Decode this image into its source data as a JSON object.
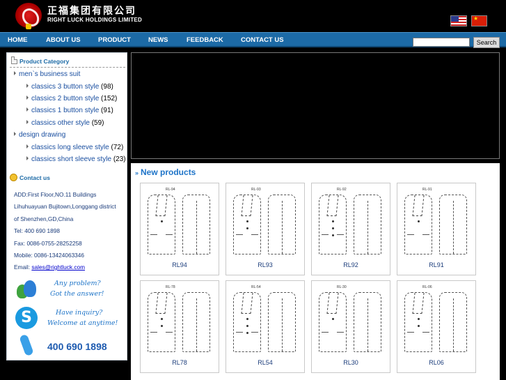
{
  "brand": {
    "name_cn": "正福集团有限公司",
    "name_en": "RIGHT LUCK HOLDINGS LIMITED"
  },
  "nav": {
    "items": [
      "HOME",
      "ABOUT US",
      "PRODUCT",
      "NEWS",
      "FEEDBACK",
      "CONTACT US"
    ],
    "search_value": "",
    "search_button": "Search"
  },
  "sidebar": {
    "category_title": "Product Category",
    "categories": [
      {
        "label": "men`s business suit",
        "count": "",
        "level": 1
      },
      {
        "label": "classics 3 button style",
        "count": "(98)",
        "level": 2
      },
      {
        "label": "classics 2 button style",
        "count": "(152)",
        "level": 2
      },
      {
        "label": "classics 1 button style",
        "count": "(91)",
        "level": 2
      },
      {
        "label": "classics other style",
        "count": "(59)",
        "level": 2
      },
      {
        "label": "design drawing",
        "count": "",
        "level": 1
      },
      {
        "label": "classics long sleeve style",
        "count": "(72)",
        "level": 2
      },
      {
        "label": "classics short sleeve style",
        "count": "(23)",
        "level": 2
      }
    ],
    "contact_title": "Contact us",
    "contact_lines": [
      "ADD:First Floor,NO.11 Buildings",
      "Lihuhuayuan Bujitown,Longgang district",
      "of Shenzhen,GD,China",
      "Tel: 400 690 1898",
      "Fax: 0086-0755-28252258",
      "Mobile: 0086-13424063346"
    ],
    "email_prefix": "Email: ",
    "email": "sales@rightluck.com",
    "msn_text": [
      "Any problem?",
      "Got the answer!"
    ],
    "skype_text": [
      "Have inquiry?",
      "Welcome at anytime!"
    ],
    "phone": "400 690 1898"
  },
  "products": {
    "title": "New products",
    "items": [
      {
        "code": "RL94",
        "tag": "RL-94"
      },
      {
        "code": "RL93",
        "tag": "RL-93"
      },
      {
        "code": "RL92",
        "tag": "RL-92"
      },
      {
        "code": "RL91",
        "tag": "RL-91"
      },
      {
        "code": "RL78",
        "tag": "RL-78"
      },
      {
        "code": "RL54",
        "tag": "RL-54"
      },
      {
        "code": "RL30",
        "tag": "RL-30"
      },
      {
        "code": "RL06",
        "tag": "RL-06"
      }
    ]
  }
}
